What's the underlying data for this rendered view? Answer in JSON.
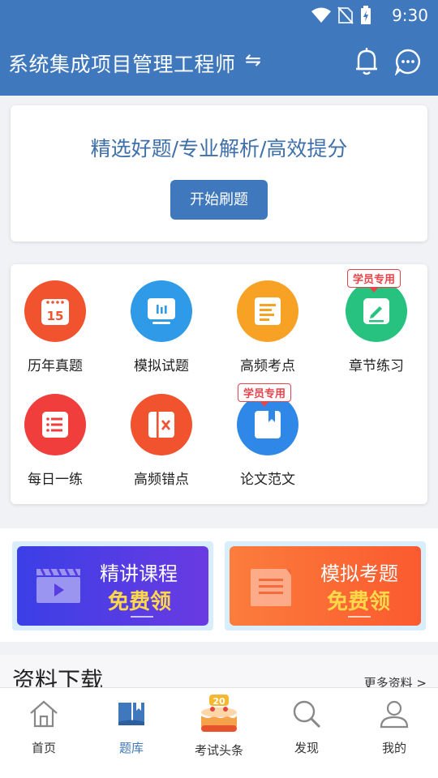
{
  "status_bar": {
    "time": "9:30"
  },
  "header": {
    "title": "系统集成项目管理工程师",
    "switch_symbol": "⇋"
  },
  "hero": {
    "slogan": "精选好题/专业解析/高效提分",
    "start_button": "开始刷题"
  },
  "features": [
    {
      "label": "历年真题",
      "icon": "calendar-icon",
      "icon_text": "15",
      "color": "#f0532e"
    },
    {
      "label": "模拟试题",
      "icon": "chart-board-icon",
      "color": "#2f9ae8"
    },
    {
      "label": "高频考点",
      "icon": "document-icon",
      "color": "#f7a224"
    },
    {
      "label": "章节练习",
      "icon": "edit-icon",
      "color": "#27c27f",
      "badge": "学员专用"
    },
    {
      "label": "每日一练",
      "icon": "list-icon",
      "color": "#ef3e3b"
    },
    {
      "label": "高频错点",
      "icon": "error-book-icon",
      "color": "#f0532e"
    },
    {
      "label": "论文范文",
      "icon": "bookmark-book-icon",
      "color": "#2f88e8",
      "badge": "学员专用"
    }
  ],
  "promos": [
    {
      "title": "精讲课程",
      "free": "免费领",
      "icon": "video-clapper-icon",
      "color": "#4b3fe0"
    },
    {
      "title": "模拟考题",
      "free": "免费领",
      "icon": "paper-icon",
      "color": "#fb5f33"
    }
  ],
  "downloads": {
    "title": "资料下载",
    "more": "更多资料 >"
  },
  "tabs": [
    {
      "label": "首页",
      "icon": "home-icon",
      "active": false
    },
    {
      "label": "题库",
      "icon": "question-bank-icon",
      "active": true
    },
    {
      "label": "考试头条",
      "icon": "cake-icon",
      "active": false
    },
    {
      "label": "发现",
      "icon": "search-icon",
      "active": false
    },
    {
      "label": "我的",
      "icon": "user-icon",
      "active": false
    }
  ],
  "colors": {
    "primary": "#3f78bd",
    "badge_red": "#e8434b",
    "active_tab": "#3f78bd"
  }
}
